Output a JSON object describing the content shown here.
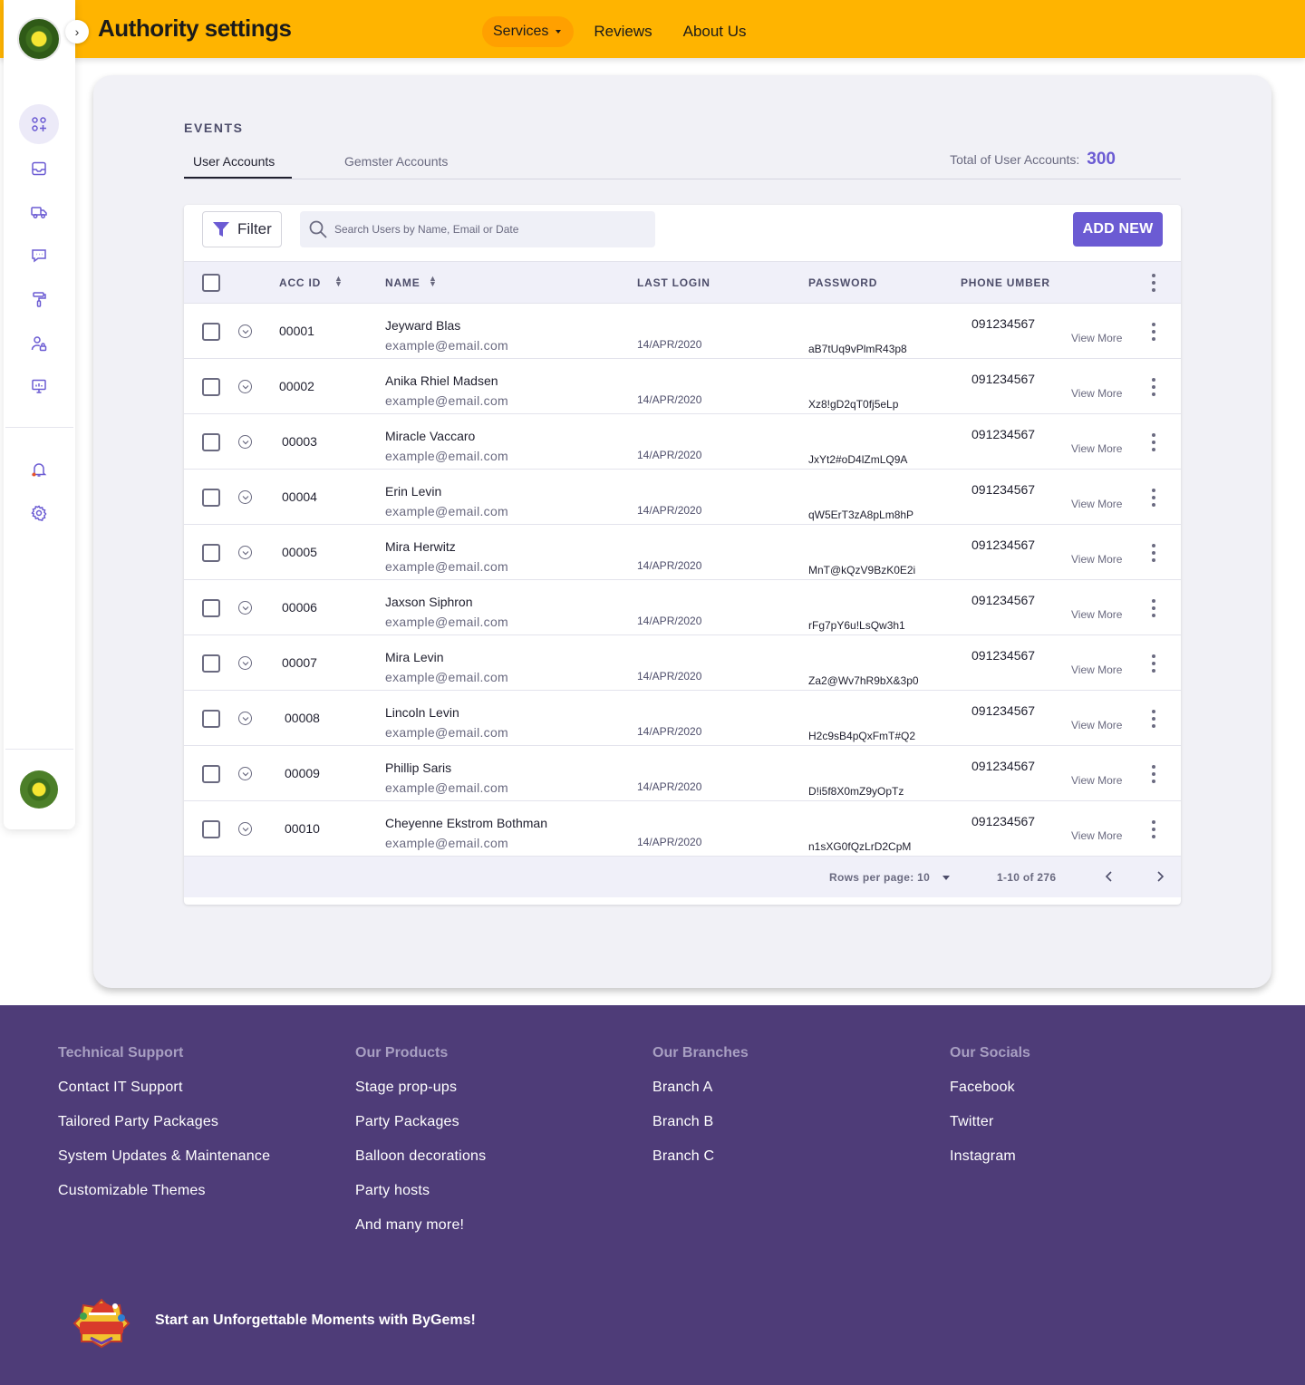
{
  "header": {
    "title": "Authority settings",
    "nav": {
      "services": "Services",
      "reviews": "Reviews",
      "about": "About Us"
    }
  },
  "sidebar": {
    "icons": [
      "dashboard-icon",
      "inbox-icon",
      "truck-icon",
      "chat-icon",
      "paint-roller-icon",
      "user-lock-icon",
      "presentation-icon",
      "bell-icon",
      "gear-icon"
    ]
  },
  "main": {
    "section_label": "EVENTS",
    "tabs": [
      "User Accounts",
      "Gemster Accounts"
    ],
    "total_label": "Total of User Accounts:",
    "total_value": "300",
    "toolbar": {
      "filter_label": "Filter",
      "search_placeholder": "Search Users by Name, Email or Date",
      "add_label": "ADD NEW"
    },
    "columns": {
      "acc_id": "ACC ID",
      "name": "NAME",
      "last_login": "LAST LOGIN",
      "password": "PASSWORD",
      "phone": "PHONE UMBER"
    },
    "view_more_label": "View More",
    "rows": [
      {
        "id": "00001",
        "name": "Jeyward Blas",
        "email": "example@email.com",
        "login": "14/APR/2020",
        "password": "aB7tUq9vPlmR43p8",
        "phone": "091234567"
      },
      {
        "id": "00002",
        "name": "Anika Rhiel Madsen",
        "email": "example@email.com",
        "login": "14/APR/2020",
        "password": "Xz8!gD2qT0fj5eLp",
        "phone": "091234567"
      },
      {
        "id": "00003",
        "name": "Miracle Vaccaro",
        "email": "example@email.com",
        "login": "14/APR/2020",
        "password": "JxYt2#oD4lZmLQ9A",
        "phone": "091234567"
      },
      {
        "id": "00004",
        "name": "Erin Levin",
        "email": "example@email.com",
        "login": "14/APR/2020",
        "password": "qW5ErT3zA8pLm8hP",
        "phone": "091234567"
      },
      {
        "id": "00005",
        "name": "Mira Herwitz",
        "email": "example@email.com",
        "login": "14/APR/2020",
        "password": "MnT@kQzV9BzK0E2i",
        "phone": "091234567"
      },
      {
        "id": "00006",
        "name": "Jaxson Siphron",
        "email": "example@email.com",
        "login": "14/APR/2020",
        "password": "rFg7pY6u!LsQw3h1",
        "phone": "091234567"
      },
      {
        "id": "00007",
        "name": "Mira Levin",
        "email": "example@email.com",
        "login": "14/APR/2020",
        "password": "Za2@Wv7hR9bX&3p0",
        "phone": "091234567"
      },
      {
        "id": "00008",
        "name": "Lincoln Levin",
        "email": "example@email.com",
        "login": "14/APR/2020",
        "password": "H2c9sB4pQxFmT#Q2",
        "phone": "091234567"
      },
      {
        "id": "00009",
        "name": "Phillip Saris",
        "email": "example@email.com",
        "login": "14/APR/2020",
        "password": "D!i5f8X0mZ9yOpTz",
        "phone": "091234567"
      },
      {
        "id": "00010",
        "name": "Cheyenne Ekstrom Bothman",
        "email": "example@email.com",
        "login": "14/APR/2020",
        "password": "n1sXG0fQzLrD2CpM",
        "phone": "091234567"
      }
    ],
    "pagination": {
      "rows_per_page": "Rows per page: 10",
      "range": "1-10 of 276"
    }
  },
  "footer": {
    "columns": [
      {
        "title": "Technical Support",
        "links": [
          "Contact IT Support",
          "Tailored Party Packages",
          "System Updates & Maintenance",
          "Customizable Themes"
        ]
      },
      {
        "title": "Our Products",
        "links": [
          "Stage prop-ups",
          "Party Packages",
          "Balloon decorations",
          "Party hosts",
          "And many more!"
        ]
      },
      {
        "title": "Our Branches",
        "links": [
          "Branch A",
          "Branch B",
          "Branch C"
        ]
      },
      {
        "title": "Our Socials",
        "links": [
          "Facebook",
          "Twitter",
          "Instagram"
        ]
      }
    ],
    "tagline": "Start an Unforgettable Moments with ByGems!",
    "logo_text": "BYGEMS PARTY"
  },
  "colors": {
    "header": "#ffb400",
    "accent": "#6b5bd3",
    "footer": "#4e3c78"
  }
}
